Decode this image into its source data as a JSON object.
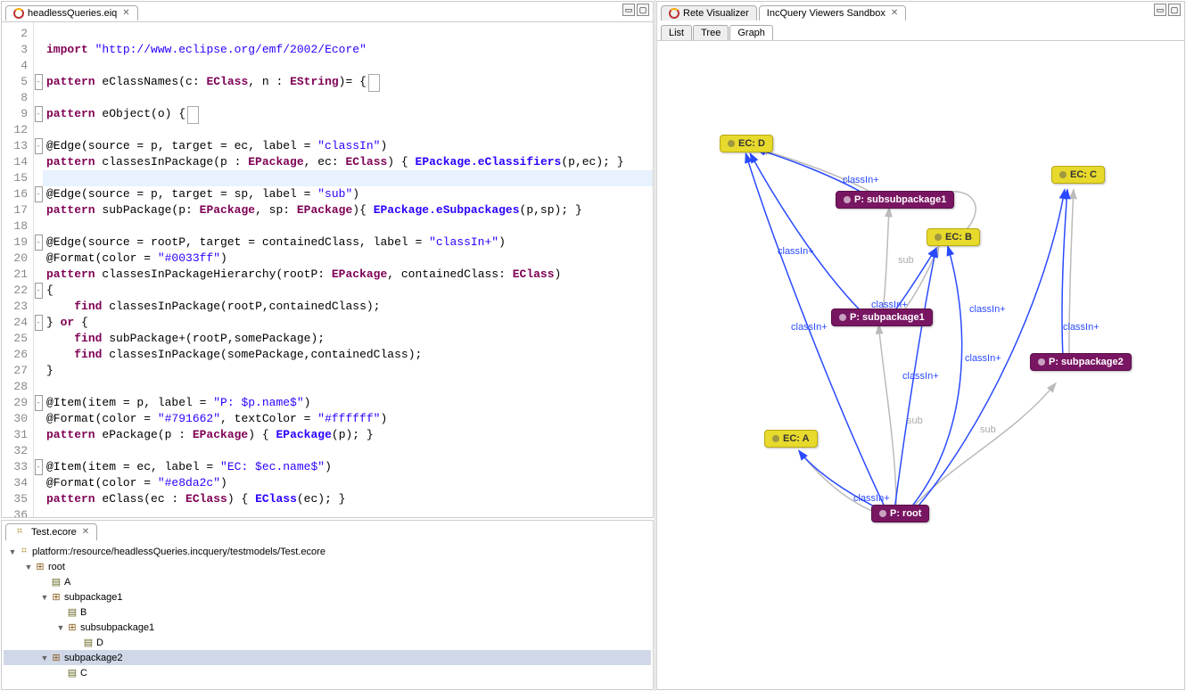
{
  "leftEditor": {
    "tabLabel": "headlessQueries.eiq",
    "lines": [
      {
        "n": "2",
        "fold": "",
        "code": ""
      },
      {
        "n": "3",
        "fold": "",
        "code": "<span class='kw'>import</span> <span class='str'>\"http://www.eclipse.org/emf/2002/Ecore\"</span>"
      },
      {
        "n": "4",
        "fold": "",
        "code": ""
      },
      {
        "n": "5",
        "fold": "-",
        "code": "<span class='kw'>pattern</span> eClassNames(c: <span class='type'>EClass</span>, n : <span class='type'>EString</span>)= {<span class='foldbox'>&nbsp;</span>"
      },
      {
        "n": "8",
        "fold": "",
        "code": ""
      },
      {
        "n": "9",
        "fold": "-",
        "code": "<span class='kw'>pattern</span> eObject(o) {<span class='foldbox'>&nbsp;</span>"
      },
      {
        "n": "12",
        "fold": "",
        "code": ""
      },
      {
        "n": "13",
        "fold": "-",
        "code": "@Edge(source = p, target = ec, label = <span class='str'>\"classIn\"</span>)"
      },
      {
        "n": "14",
        "fold": "",
        "code": "<span class='kw'>pattern</span> classesInPackage(p : <span class='type'>EPackage</span>, ec: <span class='type'>EClass</span>) { <span class='call'>EPackage.eClassifiers</span>(p,ec); }"
      },
      {
        "n": "15",
        "fold": "",
        "code": "",
        "hl": true
      },
      {
        "n": "16",
        "fold": "-",
        "code": "@Edge(source = p, target = sp, label = <span class='str'>\"sub\"</span>)"
      },
      {
        "n": "17",
        "fold": "",
        "code": "<span class='kw'>pattern</span> subPackage(p: <span class='type'>EPackage</span>, sp: <span class='type'>EPackage</span>){ <span class='call'>EPackage.eSubpackages</span>(p,sp); }"
      },
      {
        "n": "18",
        "fold": "",
        "code": ""
      },
      {
        "n": "19",
        "fold": "-",
        "code": "@Edge(source = rootP, target = containedClass, label = <span class='str'>\"classIn+\"</span>)"
      },
      {
        "n": "20",
        "fold": "",
        "code": "@Format(color = <span class='str'>\"#0033ff\"</span>)"
      },
      {
        "n": "21",
        "fold": "",
        "code": "<span class='kw'>pattern</span> classesInPackageHierarchy(rootP: <span class='type'>EPackage</span>, containedClass: <span class='type'>EClass</span>)"
      },
      {
        "n": "22",
        "fold": "-",
        "code": "{"
      },
      {
        "n": "23",
        "fold": "",
        "code": "    <span class='kw'>find</span> classesInPackage(rootP,containedClass);"
      },
      {
        "n": "24",
        "fold": "-",
        "code": "} <span class='kw'>or</span> {"
      },
      {
        "n": "25",
        "fold": "",
        "code": "    <span class='kw'>find</span> subPackage+(rootP,somePackage);"
      },
      {
        "n": "26",
        "fold": "",
        "code": "    <span class='kw'>find</span> classesInPackage(somePackage,containedClass);"
      },
      {
        "n": "27",
        "fold": "",
        "code": "}"
      },
      {
        "n": "28",
        "fold": "",
        "code": ""
      },
      {
        "n": "29",
        "fold": "-",
        "code": "@Item(item = p, label = <span class='str'>\"P: $p.name$\"</span>)"
      },
      {
        "n": "30",
        "fold": "",
        "code": "@Format(color = <span class='str'>\"#791662\"</span>, textColor = <span class='str'>\"#ffffff\"</span>)"
      },
      {
        "n": "31",
        "fold": "",
        "code": "<span class='kw'>pattern</span> ePackage(p : <span class='type'>EPackage</span>) { <span class='call'>EPackage</span>(p); }"
      },
      {
        "n": "32",
        "fold": "",
        "code": ""
      },
      {
        "n": "33",
        "fold": "-",
        "code": "@Item(item = ec, label = <span class='str'>\"EC: $ec.name$\"</span>)"
      },
      {
        "n": "34",
        "fold": "",
        "code": "@Format(color = <span class='str'>\"#e8da2c\"</span>)"
      },
      {
        "n": "35",
        "fold": "",
        "code": "<span class='kw'>pattern</span> eClass(ec : <span class='type'>EClass</span>) { <span class='call'>EClass</span>(ec); }"
      },
      {
        "n": "36",
        "fold": "",
        "code": ""
      }
    ]
  },
  "bottomPane": {
    "tabLabel": "Test.ecore",
    "rows": [
      {
        "depth": 0,
        "twisty": "▼",
        "icon": "file",
        "label": "platform:/resource/headlessQueries.incquery/testmodels/Test.ecore",
        "sel": false
      },
      {
        "depth": 1,
        "twisty": "▼",
        "icon": "pkg",
        "label": "root",
        "sel": false
      },
      {
        "depth": 2,
        "twisty": "",
        "icon": "cls",
        "label": "A",
        "sel": false
      },
      {
        "depth": 2,
        "twisty": "▼",
        "icon": "pkg",
        "label": "subpackage1",
        "sel": false
      },
      {
        "depth": 3,
        "twisty": "",
        "icon": "cls",
        "label": "B",
        "sel": false
      },
      {
        "depth": 3,
        "twisty": "▼",
        "icon": "pkg",
        "label": "subsubpackage1",
        "sel": false
      },
      {
        "depth": 4,
        "twisty": "",
        "icon": "cls",
        "label": "D",
        "sel": false
      },
      {
        "depth": 2,
        "twisty": "▼",
        "icon": "pkg",
        "label": "subpackage2",
        "sel": true
      },
      {
        "depth": 3,
        "twisty": "",
        "icon": "cls",
        "label": "C",
        "sel": false
      }
    ]
  },
  "rightPane": {
    "tabs": {
      "visualizer": "Rete Visualizer",
      "sandbox": "IncQuery Viewers Sandbox"
    },
    "subtabs": {
      "list": "List",
      "tree": "Tree",
      "graph": "Graph"
    },
    "nodes": {
      "root": "P: root",
      "sp1": "P: subpackage1",
      "sp2": "P: subpackage2",
      "ssp1": "P: subsubpackage1",
      "eca": "EC: A",
      "ecb": "EC: B",
      "ecc": "EC: C",
      "ecd": "EC: D"
    },
    "edgeLabels": {
      "classInPlus": "classIn+",
      "classIn": "classIn",
      "sub": "sub"
    }
  },
  "icons": {
    "min": "▭",
    "max": "▢"
  }
}
